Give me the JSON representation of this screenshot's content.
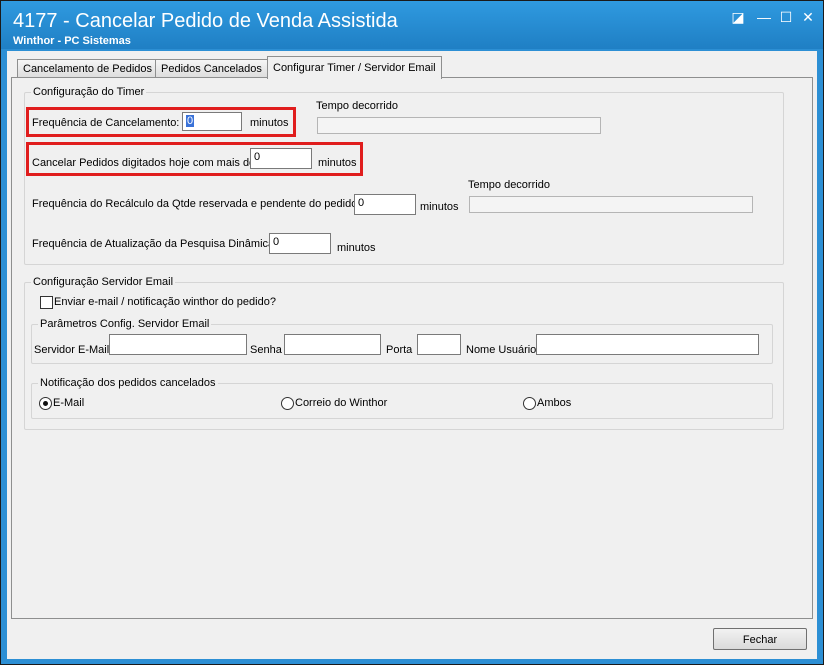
{
  "window": {
    "title": "4177 - Cancelar Pedido de Venda Assistida",
    "subtitle": "Winthor - PC Sistemas",
    "icons": [
      "restore-icon",
      "minimize-icon",
      "maximize-icon",
      "close-icon"
    ],
    "restore_glyph": "◪",
    "minimize_glyph": "—",
    "maximize_glyph": "☐",
    "close_glyph": "✕"
  },
  "tabs": [
    {
      "label": "Cancelamento de Pedidos"
    },
    {
      "label": "Pedidos Cancelados"
    },
    {
      "label": "Configurar Timer / Servidor Email",
      "active": true
    }
  ],
  "timer": {
    "group_label": "Configuração do Timer",
    "freq_cancel_label": "Frequência de Cancelamento:",
    "freq_cancel_value": "0",
    "freq_cancel_unit": "minutos",
    "elapsed_label_1": "Tempo decorrido",
    "elapsed_value_1": "",
    "cancel_today_label": "Cancelar Pedidos digitados hoje com mais de",
    "cancel_today_value": "0",
    "cancel_today_unit": "minutos",
    "elapsed_label_2": "Tempo decorrido",
    "elapsed_value_2": "",
    "recalc_label": "Frequência do Recálculo da Qtde reservada e pendente do pedido",
    "recalc_value": "0",
    "recalc_unit": "minutos",
    "update_label": "Frequência de Atualização da Pesquisa Dinâmica",
    "update_value": "0",
    "update_unit": "minutos"
  },
  "email": {
    "group_label": "Configuração Servidor Email",
    "send_checkbox_label": "Enviar e-mail / notificação winthor do pedido?",
    "send_checked": false,
    "params_group_label": "Parâmetros Config. Servidor Email",
    "server_label": "Servidor E-Mail",
    "server_value": "",
    "password_label": "Senha",
    "password_value": "",
    "port_label": "Porta",
    "port_value": "",
    "user_label": "Nome Usuário",
    "user_value": "",
    "notif_group_label": "Notificação dos pedidos cancelados",
    "options": [
      "E-Mail",
      "Correio do Winthor",
      "Ambos"
    ],
    "selected_option": "E-Mail"
  },
  "footer": {
    "close_button": "Fechar"
  },
  "colors": {
    "titlebar": "#1f7fc4",
    "highlight": "#e01d1d",
    "selection": "#3a72d8"
  }
}
